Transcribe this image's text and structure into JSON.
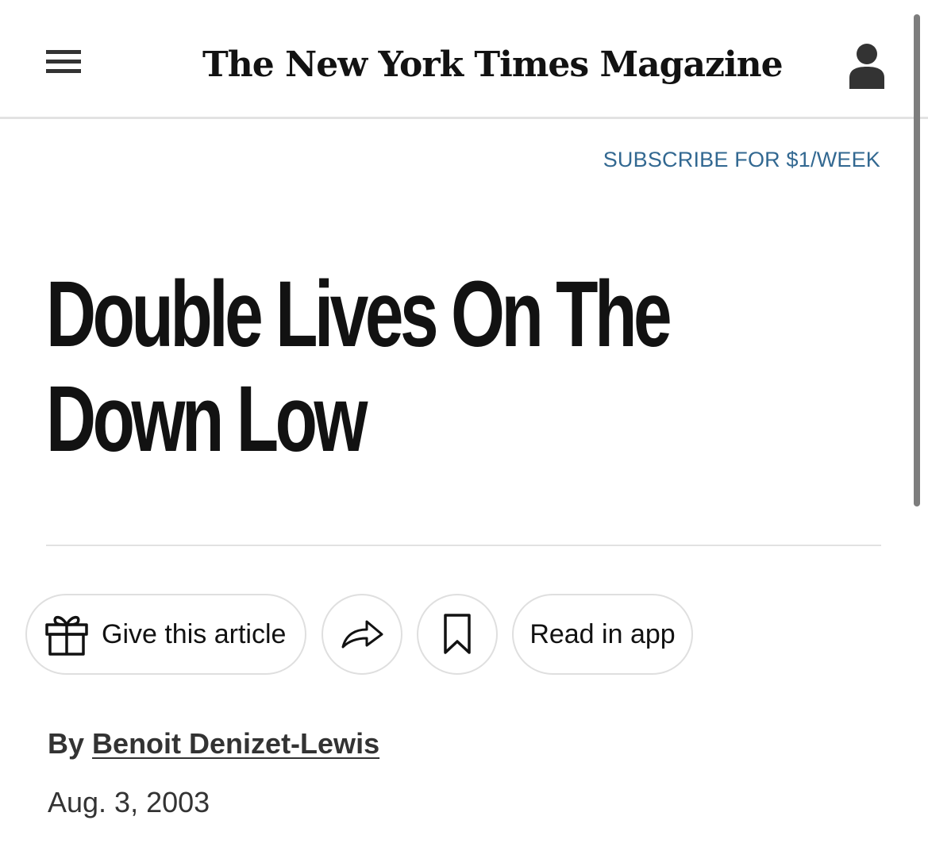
{
  "header": {
    "masthead": "The New York Times Magazine"
  },
  "subscribe_label": "SUBSCRIBE FOR $1/WEEK",
  "article": {
    "headline_lines": [
      "Double Lives On The",
      "Down Low"
    ],
    "byline_prefix": "By",
    "author": "Benoit Denizet-Lewis",
    "date": "Aug. 3, 2003"
  },
  "actions": {
    "give_label": "Give this article",
    "read_in_app_label": "Read in app"
  },
  "icons": {
    "menu": "hamburger-menu-icon",
    "account": "user-icon",
    "gift": "gift-icon",
    "share": "share-arrow-icon",
    "bookmark": "bookmark-icon"
  },
  "colors": {
    "text": "#121212",
    "link_blue": "#326891",
    "divider": "#e2e2e2",
    "pill_border": "#dfdfdf"
  }
}
